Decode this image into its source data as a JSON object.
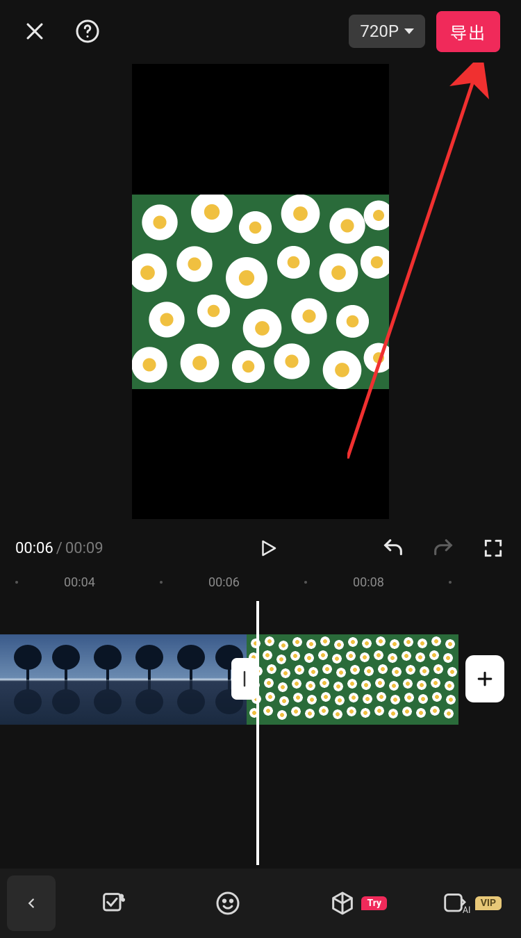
{
  "header": {
    "resolution_label": "720P",
    "export_label": "导出"
  },
  "playback": {
    "current_time": "00:06",
    "duration": "00:09"
  },
  "ruler": {
    "ticks": [
      "00:04",
      "00:06",
      "00:08"
    ]
  },
  "toolbar": {
    "try_badge": "Try",
    "vip_badge": "VIP"
  }
}
